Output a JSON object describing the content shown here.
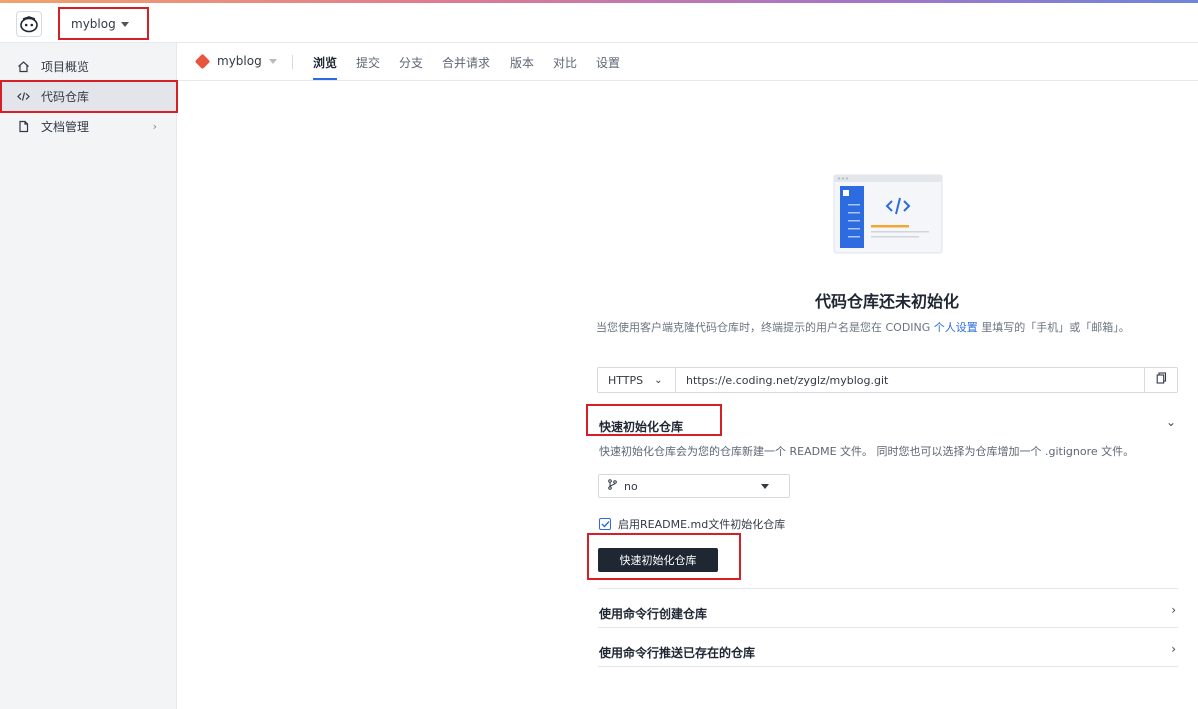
{
  "header": {
    "project_name": "myblog"
  },
  "sidebar": {
    "items": [
      {
        "label": "项目概览",
        "icon": "home-icon"
      },
      {
        "label": "代码仓库",
        "icon": "code-icon"
      },
      {
        "label": "文档管理",
        "icon": "document-icon"
      }
    ]
  },
  "subnav": {
    "repo": "myblog",
    "tabs": [
      "浏览",
      "提交",
      "分支",
      "合并请求",
      "版本",
      "对比",
      "设置"
    ]
  },
  "empty_state": {
    "title": "代码仓库还未初始化",
    "subtitle_pre": "当您使用客户端克隆代码仓库时，终端提示的用户名是您在 CODING ",
    "subtitle_link": "个人设置",
    "subtitle_post": " 里填写的「手机」或「邮箱」。"
  },
  "clone": {
    "protocol": "HTTPS",
    "url": "https://e.coding.net/zyglz/myblog.git"
  },
  "quick_init": {
    "heading": "快速初始化仓库",
    "description": "快速初始化仓库会为您的仓库新建一个 README 文件。 同时您也可以选择为仓库增加一个 .gitignore 文件。",
    "gitignore_value": "no",
    "checkbox_label": "启用README.md文件初始化仓库",
    "button_label": "快速初始化仓库"
  },
  "sections": {
    "cli_create": "使用命令行创建仓库",
    "cli_push": "使用命令行推送已存在的仓库"
  },
  "colors": {
    "accent": "#2c6ce0",
    "highlight_box": "#d71f26",
    "primary_button": "#1f2733"
  }
}
